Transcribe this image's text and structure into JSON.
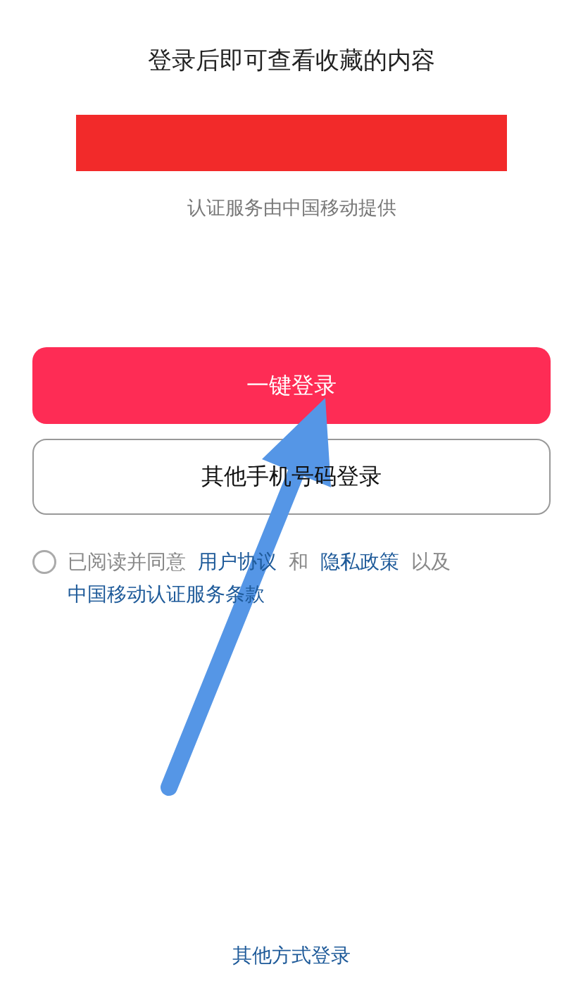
{
  "title": "登录后即可查看收藏的内容",
  "provider_note": "认证服务由中国移动提供",
  "primary_button": "一键登录",
  "secondary_button": "其他手机号码登录",
  "agreement": {
    "checked": false,
    "segments": [
      {
        "text": "已阅读并同意",
        "link": false
      },
      {
        "text": "用户协议",
        "link": true
      },
      {
        "text": "和",
        "link": false
      },
      {
        "text": "隐私政策",
        "link": true
      },
      {
        "text": "以及",
        "link": false
      },
      {
        "text": "中国移动认证服务条款",
        "link": true
      }
    ]
  },
  "other_login_link": "其他方式登录"
}
